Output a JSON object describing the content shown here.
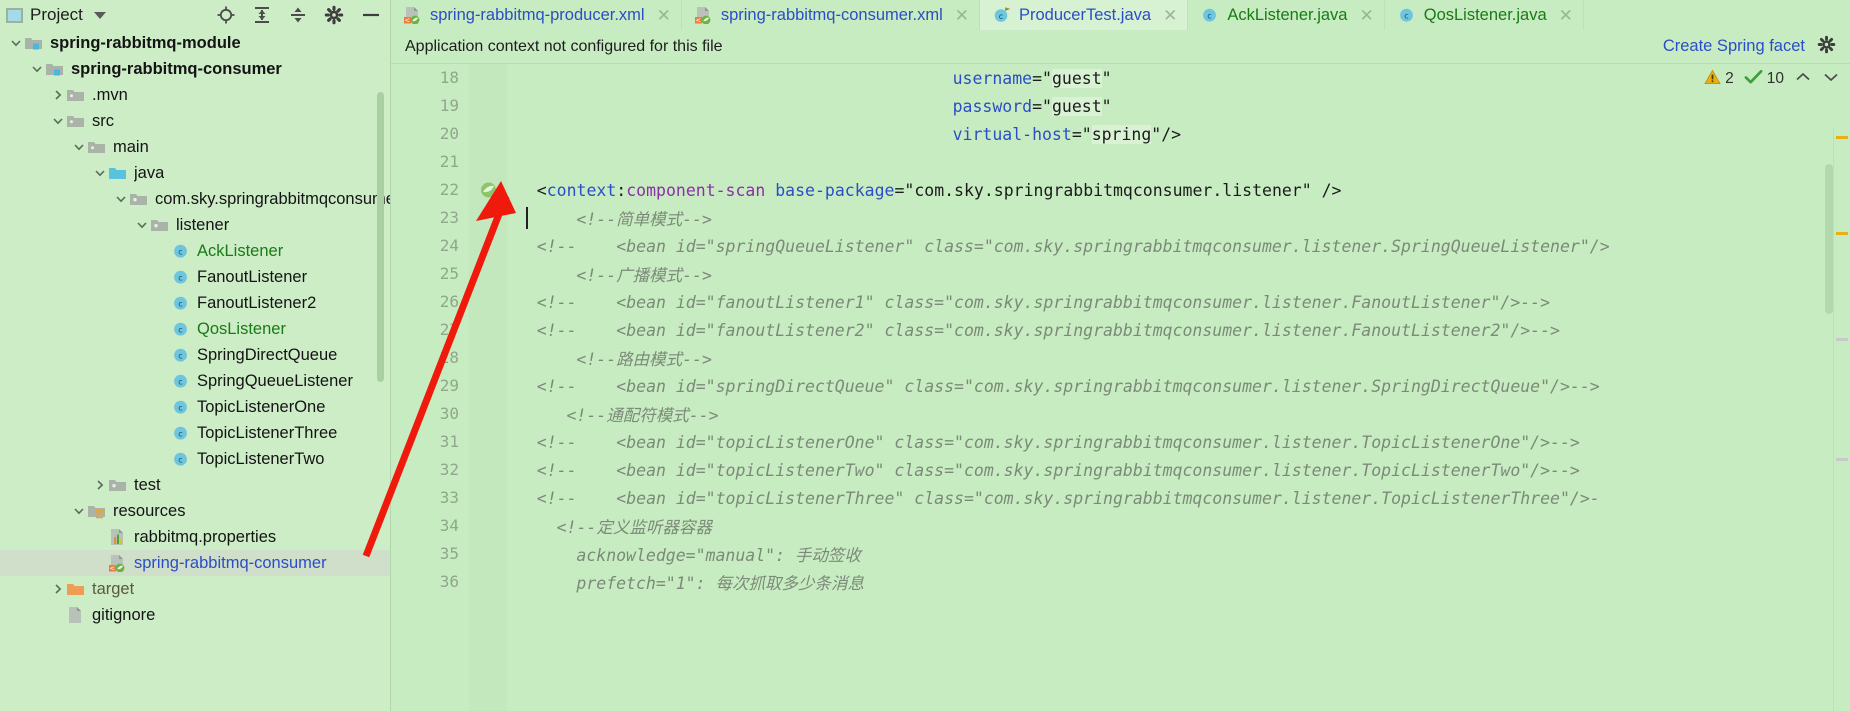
{
  "project_panel": {
    "title": "Project",
    "title_icon": "project-window-icon",
    "dropdown_icon": "chevron-down-icon",
    "toolbar_icons": [
      "locate-target-icon",
      "expand-all-icon",
      "collapse-all-icon",
      "settings-gear-icon",
      "hide-panel-icon"
    ],
    "tree": [
      {
        "label": "spring-rabbitmq-module",
        "indent": 0,
        "twisty": "down",
        "icon": "module-folder-icon",
        "style": "bold",
        "selected": false
      },
      {
        "label": "spring-rabbitmq-consumer",
        "indent": 1,
        "twisty": "down",
        "icon": "module-folder-icon",
        "style": "bold",
        "selected": false
      },
      {
        "label": ".mvn",
        "indent": 2,
        "twisty": "right",
        "icon": "folder-icon",
        "style": "normal",
        "selected": false
      },
      {
        "label": "src",
        "indent": 2,
        "twisty": "down",
        "icon": "folder-icon",
        "style": "normal",
        "selected": false
      },
      {
        "label": "main",
        "indent": 3,
        "twisty": "down",
        "icon": "folder-icon",
        "style": "normal",
        "selected": false
      },
      {
        "label": "java",
        "indent": 4,
        "twisty": "down",
        "icon": "source-root-icon",
        "style": "normal",
        "selected": false
      },
      {
        "label": "com.sky.springrabbitmqconsumer",
        "indent": 5,
        "twisty": "down",
        "icon": "package-icon",
        "style": "normal",
        "selected": false
      },
      {
        "label": "listener",
        "indent": 6,
        "twisty": "down",
        "icon": "package-icon",
        "style": "normal",
        "selected": false
      },
      {
        "label": "AckListener",
        "indent": 7,
        "twisty": "none",
        "icon": "java-class-icon",
        "style": "green",
        "selected": false
      },
      {
        "label": "FanoutListener",
        "indent": 7,
        "twisty": "none",
        "icon": "java-class-icon",
        "style": "normal",
        "selected": false
      },
      {
        "label": "FanoutListener2",
        "indent": 7,
        "twisty": "none",
        "icon": "java-class-icon",
        "style": "normal",
        "selected": false
      },
      {
        "label": "QosListener",
        "indent": 7,
        "twisty": "none",
        "icon": "java-class-icon",
        "style": "green",
        "selected": false
      },
      {
        "label": "SpringDirectQueue",
        "indent": 7,
        "twisty": "none",
        "icon": "java-class-icon",
        "style": "normal",
        "selected": false
      },
      {
        "label": "SpringQueueListener",
        "indent": 7,
        "twisty": "none",
        "icon": "java-class-icon",
        "style": "normal",
        "selected": false
      },
      {
        "label": "TopicListenerOne",
        "indent": 7,
        "twisty": "none",
        "icon": "java-class-icon",
        "style": "normal",
        "selected": false
      },
      {
        "label": "TopicListenerThree",
        "indent": 7,
        "twisty": "none",
        "icon": "java-class-icon",
        "style": "normal",
        "selected": false
      },
      {
        "label": "TopicListenerTwo",
        "indent": 7,
        "twisty": "none",
        "icon": "java-class-icon",
        "style": "normal",
        "selected": false
      },
      {
        "label": "test",
        "indent": 4,
        "twisty": "right",
        "icon": "package-icon",
        "style": "normal",
        "selected": false
      },
      {
        "label": "resources",
        "indent": 3,
        "twisty": "down",
        "icon": "resource-root-icon",
        "style": "normal",
        "selected": false
      },
      {
        "label": "rabbitmq.properties",
        "indent": 4,
        "twisty": "none",
        "icon": "properties-file-icon",
        "style": "normal",
        "selected": false
      },
      {
        "label": "spring-rabbitmq-consumer",
        "indent": 4,
        "twisty": "none",
        "icon": "spring-xml-icon",
        "style": "blue",
        "selected": true
      },
      {
        "label": "target",
        "indent": 2,
        "twisty": "right",
        "icon": "excluded-folder-icon",
        "style": "dim",
        "selected": false
      },
      {
        "label": "gitignore",
        "indent": 2,
        "twisty": "none",
        "icon": "file-icon",
        "style": "normal",
        "selected": false
      }
    ]
  },
  "tabs": [
    {
      "label": "spring-rabbitmq-producer.xml",
      "icon": "spring-xml-icon",
      "active": false,
      "color": "blue",
      "close_icon": "close-icon"
    },
    {
      "label": "spring-rabbitmq-consumer.xml",
      "icon": "spring-xml-icon",
      "active": false,
      "color": "blue",
      "close_icon": "close-icon"
    },
    {
      "label": "ProducerTest.java",
      "icon": "java-test-icon",
      "active": true,
      "color": "blue",
      "close_icon": "close-icon"
    },
    {
      "label": "AckListener.java",
      "icon": "java-class-icon",
      "active": false,
      "color": "green",
      "close_icon": "close-icon"
    },
    {
      "label": "QosListener.java",
      "icon": "java-class-icon",
      "active": false,
      "color": "green",
      "close_icon": "close-icon"
    }
  ],
  "notification": {
    "message": "Application context not configured for this file",
    "action_label": "Create Spring facet",
    "settings_icon": "gear-icon"
  },
  "inspections": {
    "warning_icon": "warning-triangle-icon",
    "warning_count": "2",
    "ok_icon": "checkmark-icon",
    "ok_count": "10",
    "prev_icon": "chevron-up-icon",
    "next_icon": "chevron-down-icon"
  },
  "editor": {
    "first_line_number": 18,
    "lines": [
      {
        "n": "18",
        "indent": 44,
        "tokens": [
          {
            "t": "username",
            "c": "attr"
          },
          {
            "t": "=",
            "c": "plain"
          },
          {
            "t": "\"",
            "c": "plain"
          },
          {
            "t": "guest",
            "c": "str-hl"
          },
          {
            "t": "\"",
            "c": "plain"
          }
        ]
      },
      {
        "n": "19",
        "indent": 44,
        "tokens": [
          {
            "t": "password",
            "c": "attr"
          },
          {
            "t": "=",
            "c": "plain"
          },
          {
            "t": "\"",
            "c": "plain"
          },
          {
            "t": "guest",
            "c": "str-hl"
          },
          {
            "t": "\"",
            "c": "plain"
          }
        ]
      },
      {
        "n": "20",
        "indent": 44,
        "tokens": [
          {
            "t": "virtual-host",
            "c": "attr"
          },
          {
            "t": "=",
            "c": "plain"
          },
          {
            "t": "\"",
            "c": "plain"
          },
          {
            "t": "spring",
            "c": "str-hl"
          },
          {
            "t": "\"/>",
            "c": "plain"
          }
        ]
      },
      {
        "n": "21",
        "indent": 0,
        "tokens": []
      },
      {
        "n": "22",
        "indent": 2,
        "gutter_icon": "spring-bean-icon",
        "tokens": [
          {
            "t": "<",
            "c": "plain"
          },
          {
            "t": "context",
            "c": "tag"
          },
          {
            "t": ":",
            "c": "plain"
          },
          {
            "t": "component-scan",
            "c": "ns"
          },
          {
            "t": " ",
            "c": "plain"
          },
          {
            "t": "base-package",
            "c": "attr"
          },
          {
            "t": "=",
            "c": "plain"
          },
          {
            "t": "\"com.sky.springrabbitmqconsumer.listener\"",
            "c": "str"
          },
          {
            "t": " />",
            "c": "plain"
          }
        ]
      },
      {
        "n": "23",
        "indent": 6,
        "caret": true,
        "tokens": [
          {
            "t": "<!--简单模式-->",
            "c": "cmt"
          }
        ]
      },
      {
        "n": "24",
        "indent": 2,
        "tokens": [
          {
            "t": "<!--    <bean id=\"springQueueListener\" class=\"com.sky.springrabbitmqconsumer.listener.SpringQueueListener\"/>",
            "c": "cmt"
          }
        ]
      },
      {
        "n": "25",
        "indent": 6,
        "tokens": [
          {
            "t": "<!--广播模式-->",
            "c": "cmt"
          }
        ]
      },
      {
        "n": "26",
        "indent": 2,
        "tokens": [
          {
            "t": "<!--    <bean id=\"fanoutListener1\" class=\"com.sky.springrabbitmqconsumer.listener.FanoutListener\"/>-->",
            "c": "cmt"
          }
        ]
      },
      {
        "n": "27",
        "indent": 2,
        "tokens": [
          {
            "t": "<!--    <bean id=\"fanoutListener2\" class=\"com.sky.springrabbitmqconsumer.listener.FanoutListener2\"/>-->",
            "c": "cmt"
          }
        ]
      },
      {
        "n": "28",
        "indent": 6,
        "tokens": [
          {
            "t": "<!--路由模式-->",
            "c": "cmt"
          }
        ]
      },
      {
        "n": "29",
        "indent": 2,
        "tokens": [
          {
            "t": "<!--    <bean id=\"springDirectQueue\" class=\"com.sky.springrabbitmqconsumer.listener.SpringDirectQueue\"/>-->",
            "c": "cmt"
          }
        ]
      },
      {
        "n": "30",
        "indent": 5,
        "tokens": [
          {
            "t": "<!--通配符模式-->",
            "c": "cmt"
          }
        ]
      },
      {
        "n": "31",
        "indent": 2,
        "tokens": [
          {
            "t": "<!--    <bean id=\"topicListenerOne\" class=\"com.sky.springrabbitmqconsumer.listener.TopicListenerOne\"/>-->",
            "c": "cmt"
          }
        ]
      },
      {
        "n": "32",
        "indent": 2,
        "tokens": [
          {
            "t": "<!--    <bean id=\"topicListenerTwo\" class=\"com.sky.springrabbitmqconsumer.listener.TopicListenerTwo\"/>-->",
            "c": "cmt"
          }
        ]
      },
      {
        "n": "33",
        "indent": 2,
        "tokens": [
          {
            "t": "<!--    <bean id=\"topicListenerThree\" class=\"com.sky.springrabbitmqconsumer.listener.TopicListenerThree\"/>-",
            "c": "cmt"
          }
        ]
      },
      {
        "n": "34",
        "indent": 4,
        "tokens": [
          {
            "t": "<!--定义监听器容器",
            "c": "cmt"
          }
        ]
      },
      {
        "n": "35",
        "indent": 6,
        "tokens": [
          {
            "t": "acknowledge=\"manual\": 手动签收",
            "c": "cmt"
          }
        ]
      },
      {
        "n": "36",
        "indent": 6,
        "tokens": [
          {
            "t": "prefetch=\"1\": 每次抓取多少条消息",
            "c": "cmt"
          }
        ]
      }
    ]
  },
  "colors": {
    "background": "#c8ecc2",
    "panel": "#cdedc7",
    "active_tab": "#d7f2d2",
    "link": "#2b4ec6",
    "vcs_green": "#1a7a16",
    "comment": "#7b8a78",
    "arrow": "#f01a0c",
    "warning": "#e8b014",
    "ok": "#3aa13a"
  }
}
